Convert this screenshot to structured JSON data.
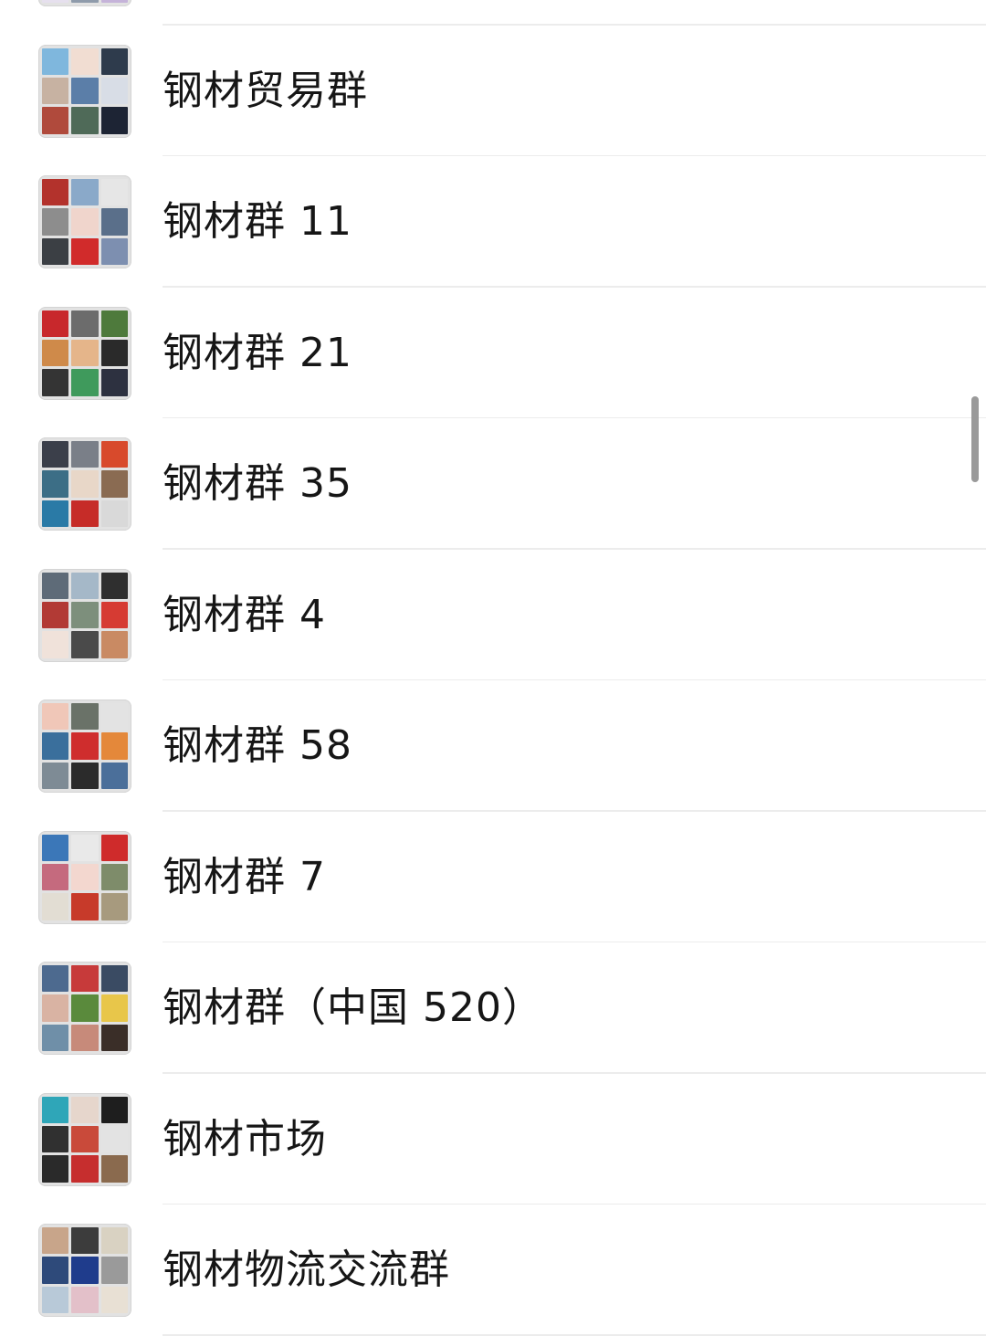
{
  "groups": [
    {
      "name": "",
      "tiles": [
        "#c9c3d6",
        "#a9b8c9",
        "#d8c8e6",
        "#6d7a8c",
        "#b7c6d8",
        "#9aa6b5",
        "#e6e0ee",
        "#8f9bab",
        "#c5b3d9"
      ]
    },
    {
      "name": "钢材贸易群",
      "tiles": [
        "#7fb7dd",
        "#f1ddd2",
        "#2e3b4c",
        "#c7b2a2",
        "#5b7ea8",
        "#d8dde6",
        "#b04a3c",
        "#4f6a58",
        "#1d2434"
      ]
    },
    {
      "name": "钢材群 11",
      "tiles": [
        "#b3322c",
        "#8aa9c9",
        "#e6e6e6",
        "#8d8d8d",
        "#f0d5cc",
        "#5a6f8a",
        "#3b3f44",
        "#d12b2b",
        "#7d8fb0"
      ]
    },
    {
      "name": "钢材群 21",
      "tiles": [
        "#c8282c",
        "#6c6c6c",
        "#4e7a3c",
        "#cf8a4a",
        "#e5b58a",
        "#2a2a2a",
        "#343434",
        "#3f9a5c",
        "#2d3140"
      ]
    },
    {
      "name": "钢材群 35",
      "tiles": [
        "#3b3f4a",
        "#7a7f88",
        "#d84a2c",
        "#3c6e86",
        "#e8d7c8",
        "#8a6b52",
        "#2a7aa6",
        "#c62c28",
        "#d9d9d9"
      ]
    },
    {
      "name": "钢材群 4",
      "tiles": [
        "#5e6b78",
        "#a5b8c8",
        "#2f2f2f",
        "#b23a35",
        "#7d8f7c",
        "#d63b33",
        "#f0e2da",
        "#4a4a4a",
        "#c98a63"
      ]
    },
    {
      "name": "钢材群 58",
      "tiles": [
        "#f0c7b8",
        "#6a7268",
        "#e3e3e3",
        "#3a6f9c",
        "#cf2d2d",
        "#e4883a",
        "#7e8b95",
        "#2b2b2b",
        "#4b6f9a"
      ]
    },
    {
      "name": "钢材群 7",
      "tiles": [
        "#3b77b8",
        "#e9e9e9",
        "#cf2b2b",
        "#c56a7e",
        "#f3d7cf",
        "#7e8c6a",
        "#e2ddd3",
        "#c73a2a",
        "#a79a7e"
      ]
    },
    {
      "name": "钢材群（中国 520）",
      "tiles": [
        "#4d6a8f",
        "#c73a3a",
        "#3a4b63",
        "#d9b3a3",
        "#5a8a3c",
        "#e8c64a",
        "#6f8fa8",
        "#c78a7a",
        "#3a2e28"
      ]
    },
    {
      "name": "钢材市场",
      "tiles": [
        "#2fa6b8",
        "#e6d6cc",
        "#1e1e1e",
        "#303030",
        "#c94a3a",
        "#e3e3e3",
        "#2a2a2a",
        "#c62e2e",
        "#8a6a4e"
      ]
    },
    {
      "name": "钢材物流交流群",
      "tiles": [
        "#c8a58a",
        "#3c3c3c",
        "#d9d2c2",
        "#2e4a7a",
        "#1f3c8c",
        "#9a9a9a",
        "#b8c9d8",
        "#e3c0c9",
        "#e8e0d4"
      ]
    }
  ]
}
